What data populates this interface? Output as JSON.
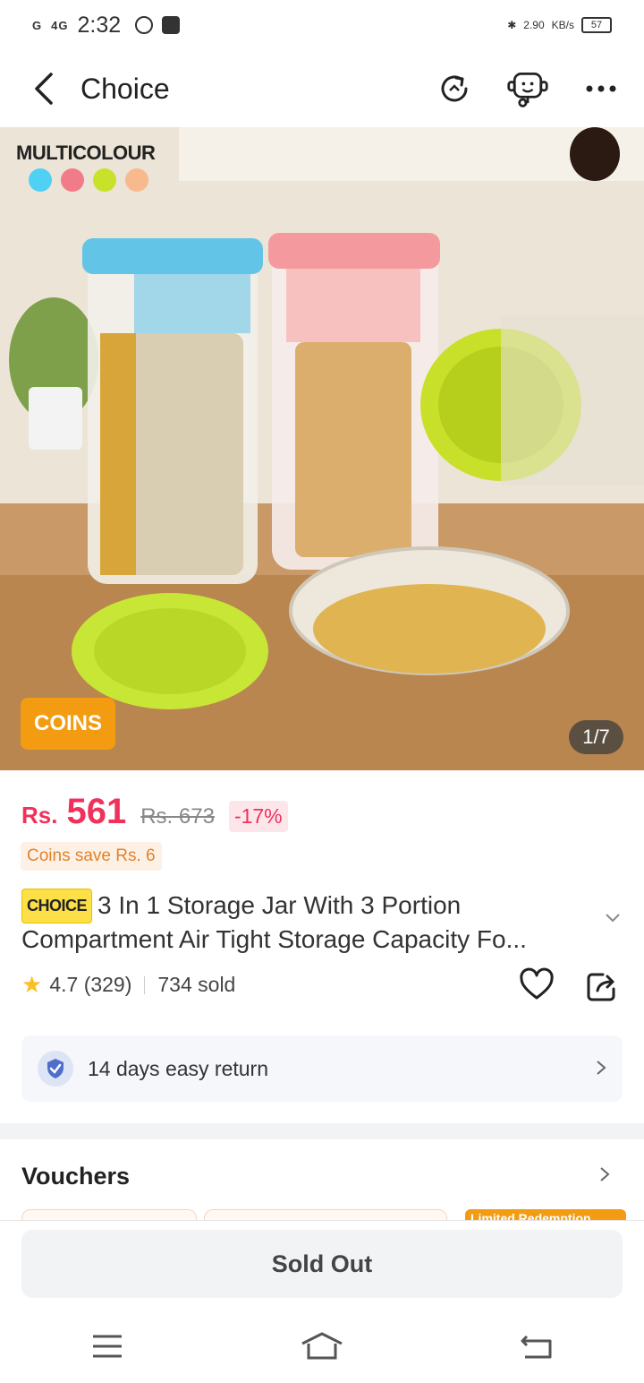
{
  "status_bar": {
    "signal_1": "G",
    "signal_2": "4G",
    "time": "2:32",
    "speed": "2.90",
    "speed_unit": "KB/s",
    "battery": "57"
  },
  "header": {
    "title": "Choice",
    "back_icon": "chevron-left-icon",
    "refresh_icon": "refresh-icon",
    "support_icon": "support-agent-icon",
    "more_icon": "more-icon"
  },
  "hero": {
    "variant_label": "MULTICOLOUR",
    "swatches": [
      "#4fd1f5",
      "#f27b8a",
      "#c8e12a",
      "#f9b98e"
    ],
    "coins_badge": "COINS",
    "counter": "1/7"
  },
  "price": {
    "currency": "Rs.",
    "current": "561",
    "original": "Rs. 673",
    "discount": "-17%",
    "coins_save": "Coins save Rs. 6"
  },
  "product": {
    "tag": "CHOICE",
    "title": "3 In 1 Storage Jar With 3 Portion Compartment Air Tight Storage Capacity Fo..."
  },
  "rating": {
    "score": "4.7",
    "count": "(329)",
    "sold": "734 sold"
  },
  "service": {
    "return_label": "14 days easy return"
  },
  "vouchers": {
    "title": "Vouchers",
    "limited": "Limited Redemption"
  },
  "bottom": {
    "sold_out": "Sold Out"
  },
  "colors": {
    "accent": "#f0315c",
    "orange": "#f39c12"
  }
}
